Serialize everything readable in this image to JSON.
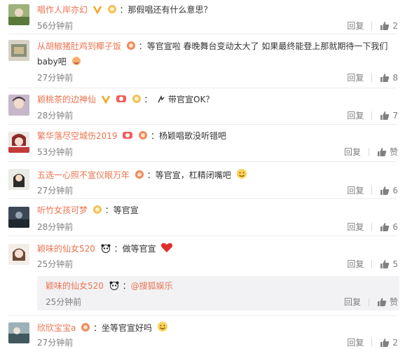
{
  "actions": {
    "reply": "回复",
    "like": "赞"
  },
  "comments": [
    {
      "user": "唱作人岸亦幻",
      "colon": "：",
      "text": "那假唱还有什么意思？",
      "time": "56分钟前",
      "likes": "2"
    },
    {
      "user": "从胡椒猪肚鸡到椰子饭",
      "colon": "：",
      "text": "等官宣啦 春晚舞台变动太大了 如果最终能登上那就期待一下我们baby吧",
      "time": "27分钟前",
      "likes": "8"
    },
    {
      "user": "颖桃茶的边神仙",
      "colon": "：",
      "text": "带官宣OK？",
      "time": "28分钟前",
      "likes": "7"
    },
    {
      "user": "繁华落尽空城伤2019",
      "colon": "：",
      "text": "杨颖唱歌没听错吧",
      "time": "53分钟前",
      "likes": ""
    },
    {
      "user": "五选一心照不宣仪眼万年",
      "colon": "：",
      "text": "等官宣，杠精闭嘴吧",
      "time": "27分钟前",
      "likes": "6"
    },
    {
      "user": "听竹女孩可梦",
      "colon": "：",
      "text": "等官宣",
      "time": "28分钟前",
      "likes": "6"
    },
    {
      "user": "颖味的仙女520",
      "colon": "：",
      "text": "做等官宣",
      "time": "25分钟前",
      "likes": "5"
    },
    {
      "user": "欣欣宝宝a",
      "colon": "：",
      "text": "坐等官宣好吗",
      "time": "27分钟前",
      "likes": "2"
    }
  ],
  "reply": {
    "user": "颖味的仙女520",
    "colon": "：",
    "mention": "@搜狐娱乐",
    "time": "25分钟前"
  },
  "colors": {
    "username": "#eb7350",
    "meta": "#808080",
    "reply_bg": "#f2f2f5"
  }
}
